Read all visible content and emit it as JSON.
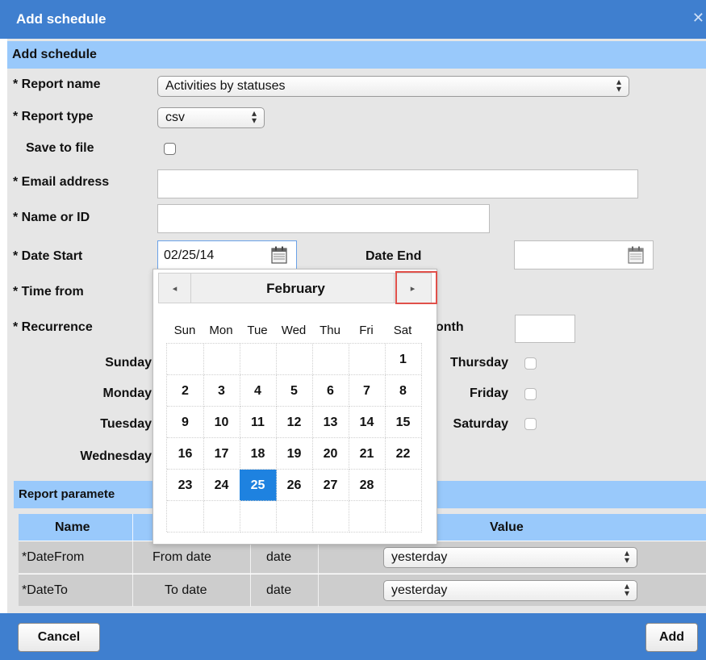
{
  "window": {
    "title": "Add schedule",
    "close_icon": "close-icon"
  },
  "section": {
    "title": "Add schedule"
  },
  "form": {
    "report_name": {
      "label": "* Report name",
      "value": "Activities by statuses"
    },
    "report_type": {
      "label": "* Report type",
      "value": "csv"
    },
    "save_to_file": {
      "label": "Save to file",
      "checked": false
    },
    "email": {
      "label": "* Email address",
      "value": ""
    },
    "name_or_id": {
      "label": "* Name or ID",
      "value": ""
    },
    "date_start": {
      "label": "* Date Start",
      "value": "02/25/14"
    },
    "date_end": {
      "label": "Date End",
      "value": ""
    },
    "time_from": {
      "label": "* Time from"
    },
    "recurrence": {
      "label": "* Recurrence",
      "month_label": "onth",
      "month_value": ""
    },
    "days": {
      "sunday": "Sunday",
      "monday": "Monday",
      "tuesday": "Tuesday",
      "wednesday": "Wednesday",
      "thursday": "Thursday",
      "friday": "Friday",
      "saturday": "Saturday"
    }
  },
  "calendar": {
    "month": "February",
    "prev_glyph": "◂",
    "next_glyph": "▸",
    "weekdays": [
      "Sun",
      "Mon",
      "Tue",
      "Wed",
      "Thu",
      "Fri",
      "Sat"
    ],
    "weeks": [
      [
        "",
        "",
        "",
        "",
        "",
        "",
        "1"
      ],
      [
        "2",
        "3",
        "4",
        "5",
        "6",
        "7",
        "8"
      ],
      [
        "9",
        "10",
        "11",
        "12",
        "13",
        "14",
        "15"
      ],
      [
        "16",
        "17",
        "18",
        "19",
        "20",
        "21",
        "22"
      ],
      [
        "23",
        "24",
        "25",
        "26",
        "27",
        "28",
        ""
      ],
      [
        "",
        "",
        "",
        "",
        "",
        "",
        ""
      ]
    ],
    "selected_day": "25",
    "selected_color": "#1e82e0"
  },
  "report_parameters": {
    "title": "Report paramete",
    "columns": {
      "name": "Name",
      "value": "Value"
    },
    "rows": [
      {
        "name": "*DateFrom",
        "label": "From date",
        "type": "date",
        "value": "yesterday"
      },
      {
        "name": "*DateTo",
        "label": "To date",
        "type": "date",
        "value": "yesterday"
      }
    ]
  },
  "footer": {
    "cancel": "Cancel",
    "add": "Add"
  },
  "colors": {
    "title_bar": "#3f7fcf",
    "section_header": "#99c9fb",
    "highlight": "#e0504a"
  }
}
